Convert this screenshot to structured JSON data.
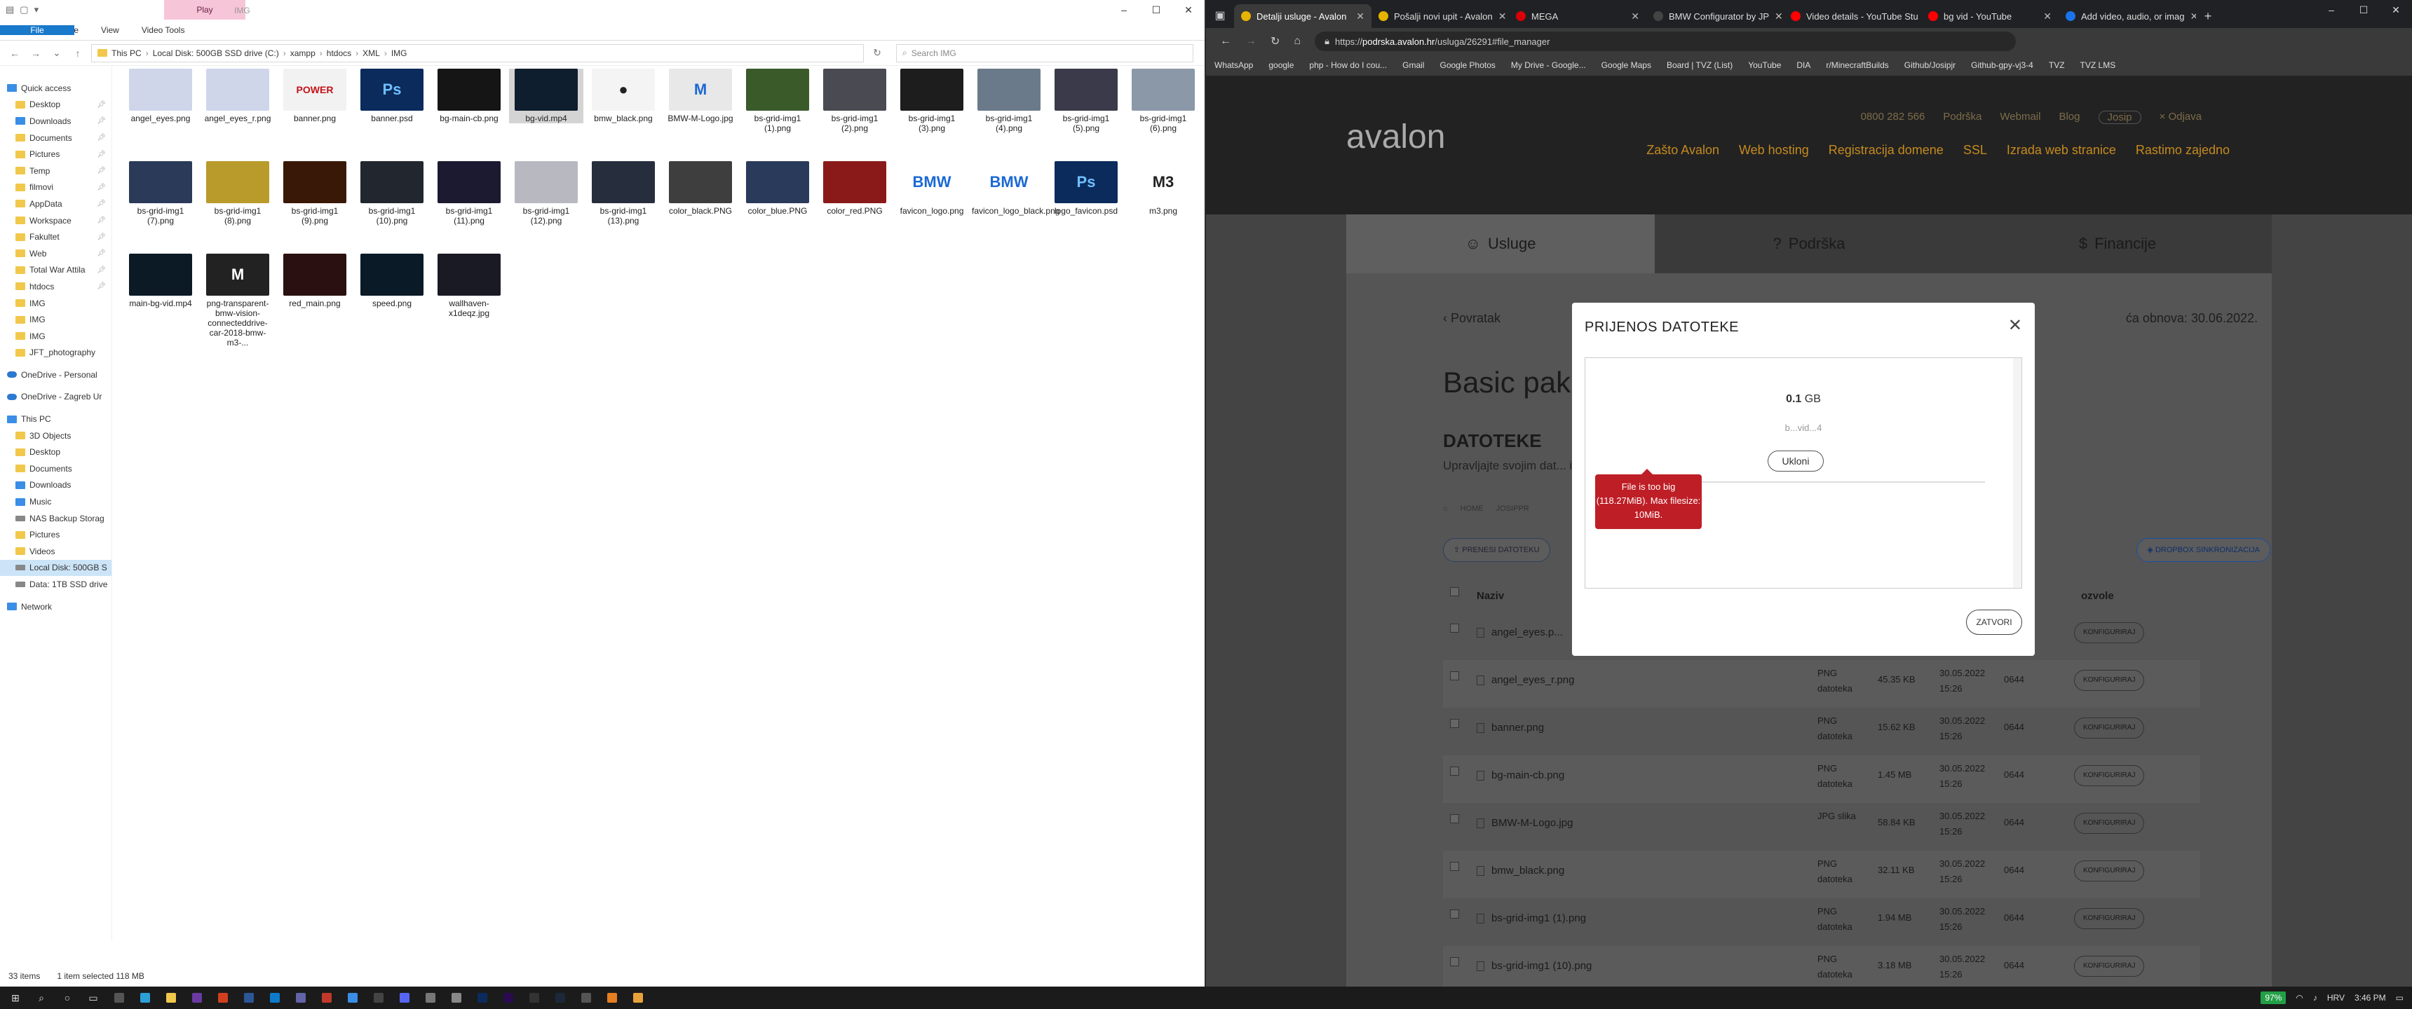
{
  "explorer": {
    "window_title": "IMG",
    "context_tab": "Play",
    "ribbon_tabs": [
      "File",
      "Home",
      "Share",
      "View",
      "Video Tools"
    ],
    "path": [
      "This PC",
      "Local Disk: 500GB SSD drive (C:)",
      "xampp",
      "htdocs",
      "XML",
      "IMG"
    ],
    "search_placeholder": "Search IMG",
    "nav": [
      {
        "label": "Quick access",
        "type": "top",
        "icon": "star-icon"
      },
      {
        "label": "Desktop",
        "icon": "folder-icon",
        "pinned": true
      },
      {
        "label": "Downloads",
        "icon": "download-icon",
        "pinned": true
      },
      {
        "label": "Documents",
        "icon": "folder-icon",
        "pinned": true
      },
      {
        "label": "Pictures",
        "icon": "folder-icon",
        "pinned": true
      },
      {
        "label": "Temp",
        "icon": "folder-icon",
        "pinned": true
      },
      {
        "label": "filmovi",
        "icon": "folder-icon",
        "pinned": true
      },
      {
        "label": "AppData",
        "icon": "folder-icon",
        "pinned": true
      },
      {
        "label": "Workspace",
        "icon": "folder-icon",
        "pinned": true
      },
      {
        "label": "Fakultet",
        "icon": "folder-icon",
        "pinned": true
      },
      {
        "label": "Web",
        "icon": "folder-icon",
        "pinned": true
      },
      {
        "label": "Total War Attila",
        "icon": "folder-icon",
        "pinned": true
      },
      {
        "label": "htdocs",
        "icon": "folder-icon",
        "pinned": true
      },
      {
        "label": "IMG",
        "icon": "folder-icon"
      },
      {
        "label": "IMG",
        "icon": "folder-icon"
      },
      {
        "label": "IMG",
        "icon": "folder-icon"
      },
      {
        "label": "JFT_photography",
        "icon": "folder-icon"
      },
      {
        "label": "OneDrive - Personal",
        "type": "top",
        "icon": "cloud-icon"
      },
      {
        "label": "OneDrive - Zagreb Ur",
        "type": "top",
        "icon": "cloud-icon"
      },
      {
        "label": "This PC",
        "type": "top",
        "icon": "pc-icon"
      },
      {
        "label": "3D Objects",
        "icon": "folder-icon"
      },
      {
        "label": "Desktop",
        "icon": "folder-icon"
      },
      {
        "label": "Documents",
        "icon": "folder-icon"
      },
      {
        "label": "Downloads",
        "icon": "download-icon"
      },
      {
        "label": "Music",
        "icon": "music-icon"
      },
      {
        "label": "NAS Backup Storag",
        "icon": "drive-icon"
      },
      {
        "label": "Pictures",
        "icon": "folder-icon"
      },
      {
        "label": "Videos",
        "icon": "folder-icon"
      },
      {
        "label": "Local Disk: 500GB S",
        "icon": "drive-icon",
        "selected": true
      },
      {
        "label": "Data: 1TB SSD drive",
        "icon": "drive-icon"
      },
      {
        "label": "Network",
        "type": "top",
        "icon": "network-icon"
      }
    ],
    "files": [
      {
        "name": "angel_eyes.png",
        "thumb": "#cfd6ea"
      },
      {
        "name": "angel_eyes_r.png",
        "thumb": "#cfd6ea"
      },
      {
        "name": "banner.png",
        "thumb": "#f2f2f2",
        "glyph": "POWER",
        "glyph_color": "#c4121a"
      },
      {
        "name": "banner.psd",
        "thumb": "#0b2b5c",
        "glyph": "Ps"
      },
      {
        "name": "bg-main-cb.png",
        "thumb": "#151515"
      },
      {
        "name": "bg-vid.mp4",
        "thumb": "#0e1e2e",
        "selected": true
      },
      {
        "name": "bmw_black.png",
        "thumb": "#f4f4f4",
        "glyph": "●",
        "glyph_color": "#222"
      },
      {
        "name": "BMW-M-Logo.jpg",
        "thumb": "#e8e8e8",
        "glyph": "M",
        "glyph_color": "#1c69d4"
      },
      {
        "name": "bs-grid-img1 (1).png",
        "thumb": "#3a5a2a"
      },
      {
        "name": "bs-grid-img1 (2).png",
        "thumb": "#4a4a52"
      },
      {
        "name": "bs-grid-img1 (3).png",
        "thumb": "#1d1d1d"
      },
      {
        "name": "bs-grid-img1 (4).png",
        "thumb": "#6a7a8a"
      },
      {
        "name": "bs-grid-img1 (5).png",
        "thumb": "#3a3a4a"
      },
      {
        "name": "bs-grid-img1 (6).png",
        "thumb": "#8a98a8"
      },
      {
        "name": "bs-grid-img1 (7).png",
        "thumb": "#2a3a58"
      },
      {
        "name": "bs-grid-img1 (8).png",
        "thumb": "#b89b2a"
      },
      {
        "name": "bs-grid-img1 (9).png",
        "thumb": "#3a1808"
      },
      {
        "name": "bs-grid-img1 (10).png",
        "thumb": "#22262e"
      },
      {
        "name": "bs-grid-img1 (11).png",
        "thumb": "#1c1a30"
      },
      {
        "name": "bs-grid-img1 (12).png",
        "thumb": "#b8b8c0"
      },
      {
        "name": "bs-grid-img1 (13).png",
        "thumb": "#262e3e"
      },
      {
        "name": "color_black.PNG",
        "thumb": "#3e3e3e"
      },
      {
        "name": "color_blue.PNG",
        "thumb": "#2a3a5a"
      },
      {
        "name": "color_red.PNG",
        "thumb": "#8a1a1a"
      },
      {
        "name": "favicon_logo.png",
        "thumb": "#ffffff",
        "glyph": "BMW",
        "glyph_color": "#1c69d4"
      },
      {
        "name": "favicon_logo_black.png",
        "thumb": "#ffffff",
        "glyph": "BMW",
        "glyph_color": "#1c69d4"
      },
      {
        "name": "logo_favicon.psd",
        "thumb": "#0b2b5c",
        "glyph": "Ps"
      },
      {
        "name": "m3.png",
        "thumb": "#ffffff",
        "glyph": "M3",
        "glyph_color": "#222"
      },
      {
        "name": "main-bg-vid.mp4",
        "thumb": "#0c1a26"
      },
      {
        "name": "png-transparent-bmw-vision-connecteddrive-car-2018-bmw-m3-...",
        "thumb": "#222",
        "glyph": "M",
        "glyph_color": "#fff"
      },
      {
        "name": "red_main.png",
        "thumb": "#2a1010"
      },
      {
        "name": "speed.png",
        "thumb": "#0a1a26"
      },
      {
        "name": "wallhaven-x1deqz.jpg",
        "thumb": "#1a1a24"
      }
    ],
    "status": {
      "count": "33 items",
      "selection": "1 item selected  118 MB"
    }
  },
  "browser": {
    "tabs": [
      {
        "title": "Detalji usluge - Avalon",
        "active": true,
        "color": "#e5b300"
      },
      {
        "title": "Pošalji novi upit - Avalon",
        "color": "#e5b300"
      },
      {
        "title": "MEGA",
        "color": "#d90007"
      },
      {
        "title": "BMW Configurator by JP",
        "color": "#444"
      },
      {
        "title": "Video details - YouTube Stu",
        "color": "#ff0000"
      },
      {
        "title": "bg vid - YouTube",
        "color": "#ff0000"
      },
      {
        "title": "Add video, audio, or imag",
        "color": "#1a73e8"
      }
    ],
    "url_pre": "https://",
    "url_host": "podrska.avalon.hr",
    "url_rest": "/usluga/26291#file_manager",
    "bookmarks": [
      "WhatsApp",
      "google",
      "php - How do I cou...",
      "Gmail",
      "Google Photos",
      "My Drive - Google...",
      "Google Maps",
      "Board | TVZ (List)",
      "YouTube",
      "DIA",
      "r/MinecraftBuilds",
      "Github/Josipjr",
      "Github-gpy-vj3-4",
      "TVZ",
      "TVZ LMS"
    ]
  },
  "site": {
    "phone": "0800 282 566",
    "support": "Podrška",
    "webmail": "Webmail",
    "blog": "Blog",
    "user": "Josip",
    "logout": "× Odjava",
    "logo": "avalon",
    "menu": [
      "Zašto Avalon",
      "Web hosting",
      "Registracija domene",
      "SSL",
      "Izrada web stranice",
      "Rastimo zajedno"
    ],
    "card_tabs": [
      "Usluge",
      "Podrška",
      "Financije"
    ],
    "back": "‹ Povratak",
    "renew": "ća obnova: 30.06.2022.",
    "page_title": "Basic pak",
    "section": "DATOTEKE",
    "description": "Upravljajte svojim dat... ili sinkronizirajte datoteke putem Drop...",
    "breadcrumb": [
      "HOME",
      "JOSIPPR"
    ],
    "upload_btn": "PRENESI DATOTEKU",
    "dropbox_btn": "DROPBOX SINKRONIZACIJA",
    "col_name": "Naziv",
    "col_perm": "ozvole",
    "configure": "KONFIGURIRAJ",
    "rows": [
      {
        "name": "angel_eyes.p...",
        "type": "",
        "size": "",
        "date": "",
        "perm": "0644"
      },
      {
        "name": "angel_eyes_r.png",
        "type": "PNG datoteka",
        "size": "45.35 KB",
        "date": "30.05.2022 15:26",
        "perm": "0644"
      },
      {
        "name": "banner.png",
        "type": "PNG datoteka",
        "size": "15.62 KB",
        "date": "30.05.2022 15:26",
        "perm": "0644"
      },
      {
        "name": "bg-main-cb.png",
        "type": "PNG datoteka",
        "size": "1.45 MB",
        "date": "30.05.2022 15:26",
        "perm": "0644"
      },
      {
        "name": "BMW-M-Logo.jpg",
        "type": "JPG slika",
        "size": "58.84 KB",
        "date": "30.05.2022 15:26",
        "perm": "0644"
      },
      {
        "name": "bmw_black.png",
        "type": "PNG datoteka",
        "size": "32.11 KB",
        "date": "30.05.2022 15:26",
        "perm": "0644"
      },
      {
        "name": "bs-grid-img1 (1).png",
        "type": "PNG datoteka",
        "size": "1.94 MB",
        "date": "30.05.2022 15:26",
        "perm": "0644"
      },
      {
        "name": "bs-grid-img1 (10).png",
        "type": "PNG datoteka",
        "size": "3.18 MB",
        "date": "30.05.2022 15:26",
        "perm": "0644"
      }
    ]
  },
  "modal": {
    "title": "PRIJENOS DATOTEKE",
    "size_num": "0.1",
    "size_unit": "GB",
    "filename": "b...vid...4",
    "remove": "Ukloni",
    "error": "File is too big (118.27MiB). Max filesize: 10MiB.",
    "close": "ZATVORI"
  },
  "taskbar": {
    "battery": "97%",
    "lang": "HRV",
    "time": "3:46 PM"
  }
}
